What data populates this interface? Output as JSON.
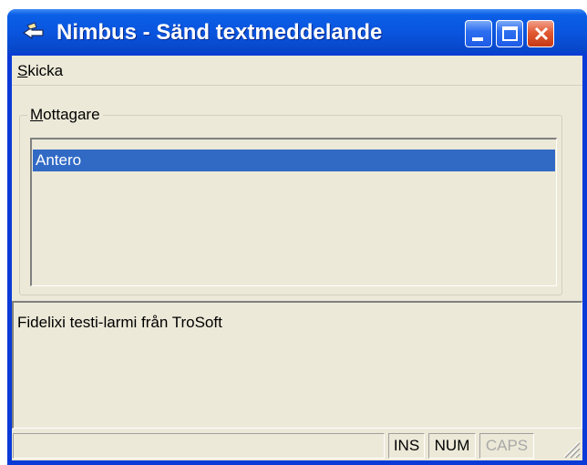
{
  "window": {
    "title": "Nimbus - Sänd textmeddelande",
    "colors": {
      "titlebar": "#0a55df",
      "client": "#ece9d8",
      "selection": "#316ac5",
      "close": "#e25a33"
    },
    "icons": [
      "app-icon",
      "minimize-icon",
      "maximize-icon",
      "close-icon"
    ]
  },
  "menu": {
    "items": [
      {
        "accel": "S",
        "rest": "kicka"
      }
    ]
  },
  "recipients": {
    "group_accel": "M",
    "group_rest": "ottagare",
    "items": [
      "Antero"
    ],
    "selected": "Antero"
  },
  "message": {
    "text": "Fidelixi testi-larmi från TroSoft"
  },
  "statusbar": {
    "ins": "INS",
    "num": "NUM",
    "caps": "CAPS",
    "caps_enabled": false
  }
}
